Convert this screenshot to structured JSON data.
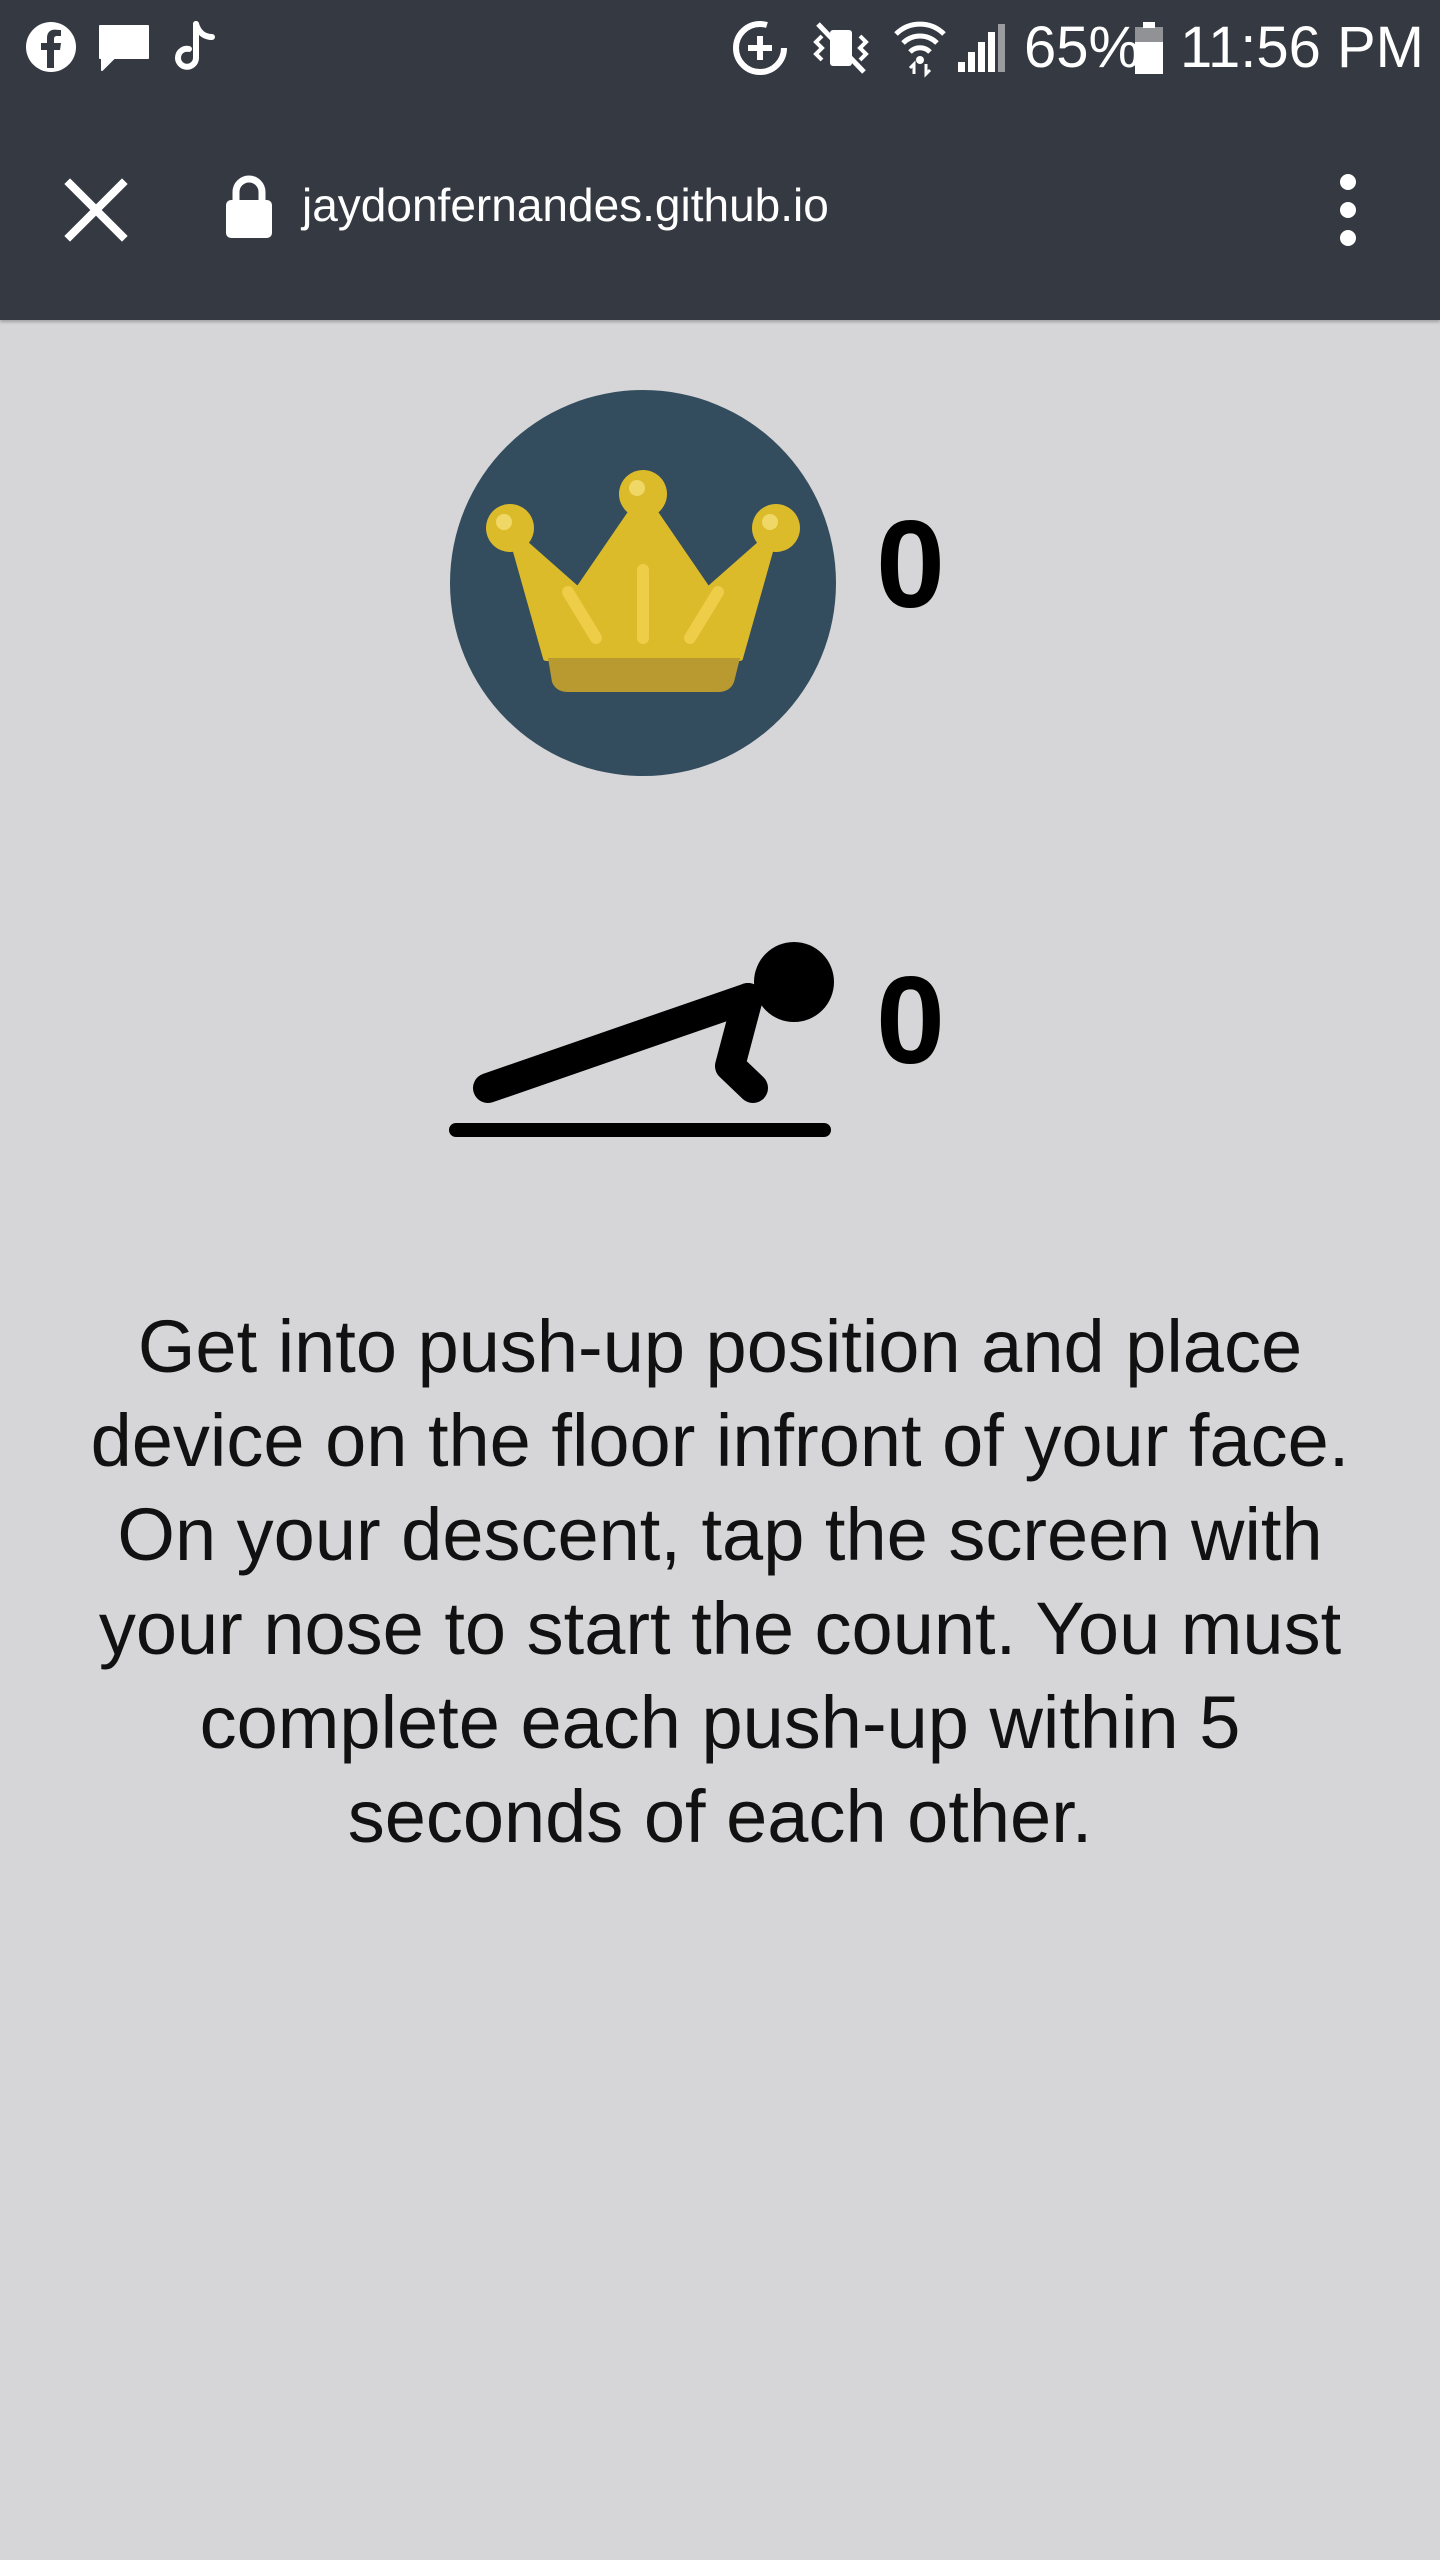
{
  "status_bar": {
    "battery_percent": "65%",
    "time": "11:56 PM",
    "left_icons": [
      "facebook-icon",
      "message-icon",
      "tiktok-icon"
    ],
    "right_icons": [
      "data-saver-icon",
      "vibrate-icon",
      "wifi-icon",
      "signal-icon",
      "battery-icon"
    ]
  },
  "browser": {
    "url": "jaydonfernandes.github.io",
    "close_icon": "close-icon",
    "lock_icon": "lock-icon",
    "menu_icon": "more-vert-icon"
  },
  "game": {
    "high_score": "0",
    "pushup_count": "0",
    "instructions": "Get into push-up position and place device on the floor infront of your face. On your descent, tap the screen with your nose to start the count. You must complete each push-up within 5 seconds of each other."
  },
  "colors": {
    "topbar": "#353941",
    "background": "#d6d6d8",
    "crown_circle": "#344d5e",
    "crown_gold": "#dcbb2a"
  }
}
